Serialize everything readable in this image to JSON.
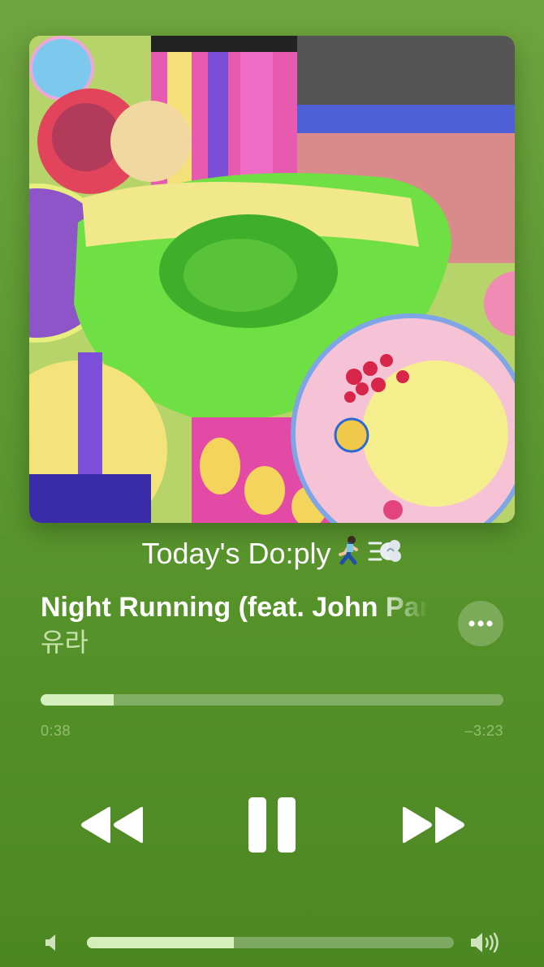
{
  "now_playing": {
    "playlist_title": "Today's Do:ply",
    "playlist_emojis": [
      "runner-emoji",
      "dash-emoji"
    ],
    "song_title": "Night Running (feat. John Park)",
    "artist": "유라",
    "more_icon": "ellipsis-icon"
  },
  "progress": {
    "elapsed": "0:38",
    "remaining": "–3:23",
    "fraction": 0.158
  },
  "controls": {
    "rewind_icon": "rewind-icon",
    "pause_icon": "pause-icon",
    "forward_icon": "fast-forward-icon"
  },
  "volume": {
    "level": 0.4,
    "low_icon": "speaker-low-icon",
    "high_icon": "speaker-high-icon"
  },
  "colors": {
    "background": "#5f9a32",
    "accent": "#dcf5c3"
  }
}
